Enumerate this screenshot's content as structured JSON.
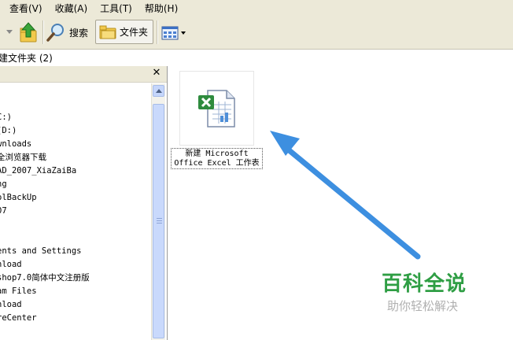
{
  "menu": {
    "items": [
      {
        "label": "查看(V)"
      },
      {
        "label": "收藏(A)"
      },
      {
        "label": "工具(T)"
      },
      {
        "label": "帮助(H)"
      }
    ]
  },
  "toolbar": {
    "search_label": "搜索",
    "folders_label": "文件夹"
  },
  "address": {
    "text": "建文件夹 (2)"
  },
  "tree": {
    "items": [
      {
        "label": "C:)"
      },
      {
        "label": " (D:)"
      },
      {
        "label": "wnloads"
      },
      {
        "label": "全浏览器下载"
      },
      {
        "label": "AD_2007_XiaZaiBa"
      },
      {
        "label": "ng"
      },
      {
        "label": "olBackUp"
      },
      {
        "label": "07"
      },
      {
        "label": ""
      },
      {
        "label": "ents and Settings"
      },
      {
        "label": "nload"
      },
      {
        "label": "shop7.0简体中文注册版"
      },
      {
        "label": "am Files"
      },
      {
        "label": "nload"
      },
      {
        "label": "reCenter"
      }
    ]
  },
  "file": {
    "name_line1": "新建 Microsoft",
    "name_line2": "Office Excel 工作表",
    "icon": "excel-file-icon"
  },
  "watermark": {
    "title": "百科全说",
    "subtitle": "助你轻松解决"
  },
  "colors": {
    "arrow": "#3d8fe0",
    "watermark_green": "#2f9e44",
    "chrome": "#ece9d8"
  }
}
